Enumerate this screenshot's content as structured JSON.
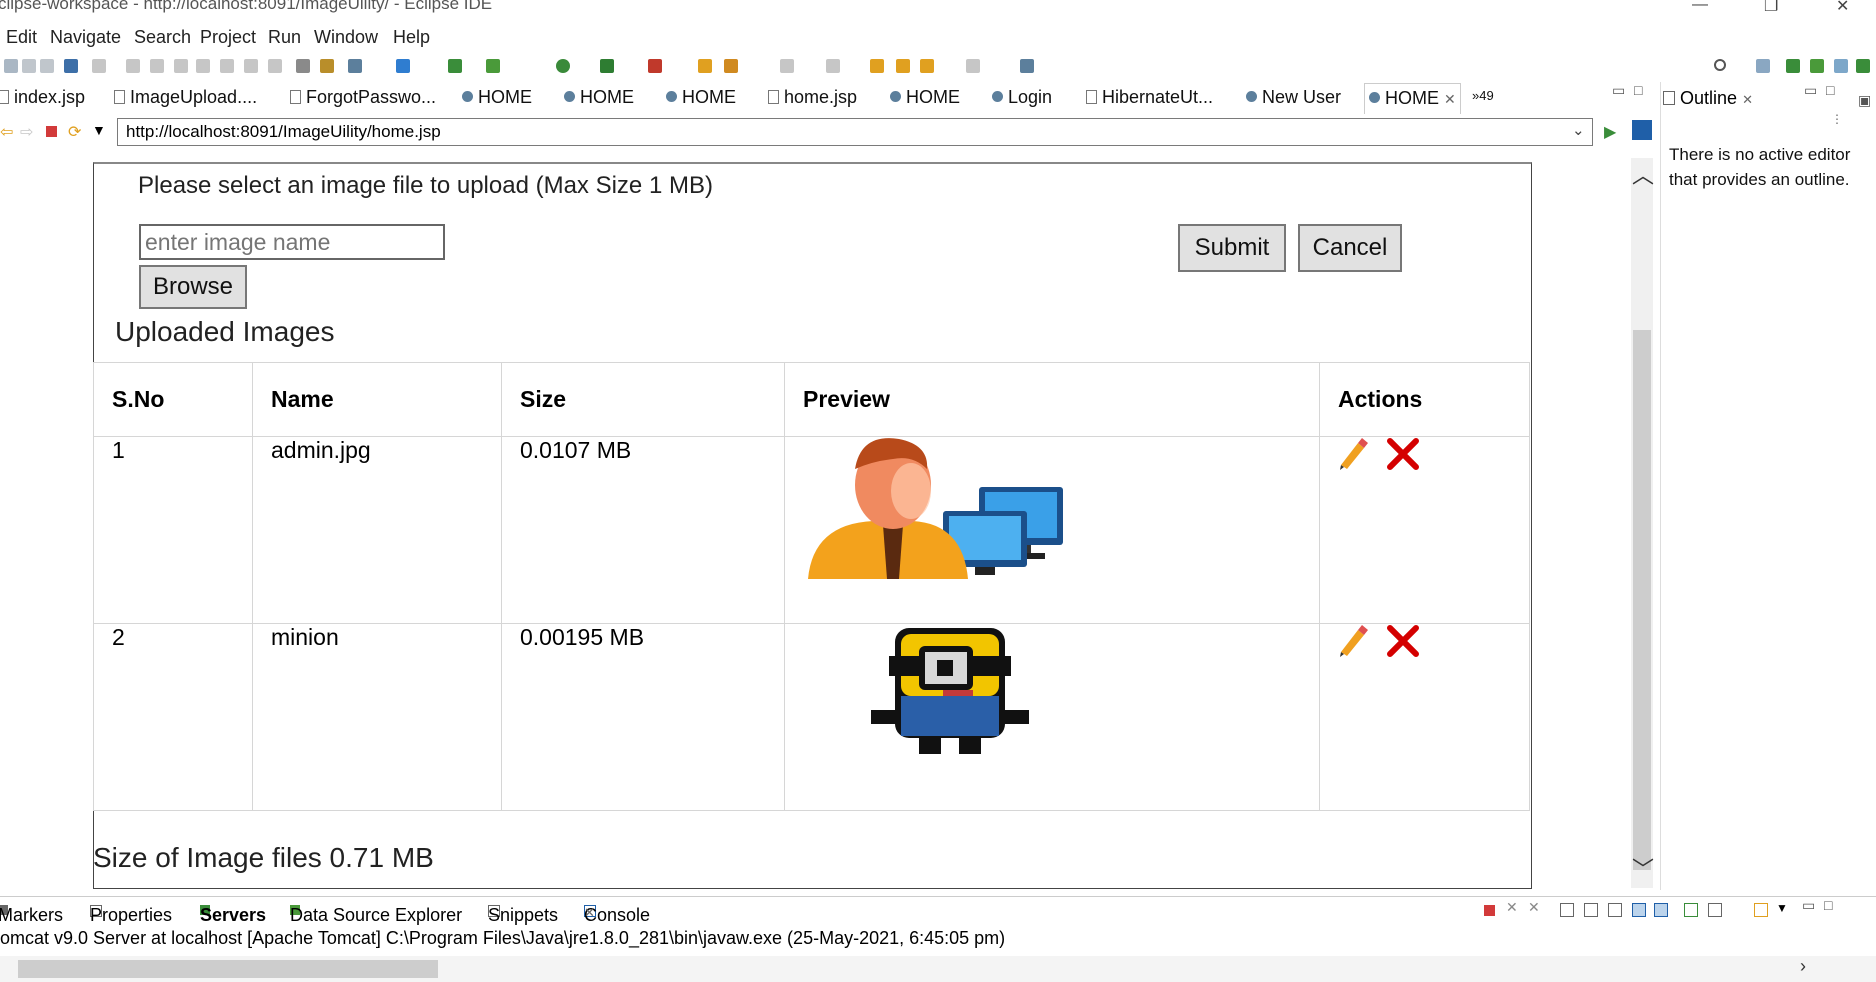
{
  "window": {
    "title": "clipse-workspace - http://localhost:8091/ImageUility/ - Eclipse IDE",
    "controls": [
      "—",
      "❐",
      "✕"
    ]
  },
  "menu": [
    "Edit",
    "Navigate",
    "Search",
    "Project",
    "Run",
    "Window",
    "Help"
  ],
  "tabs": [
    {
      "label": "index.jsp",
      "kind": "doc"
    },
    {
      "label": "ImageUpload....",
      "kind": "doc"
    },
    {
      "label": "ForgotPasswo...",
      "kind": "doc"
    },
    {
      "label": "HOME",
      "kind": "web"
    },
    {
      "label": "HOME",
      "kind": "web"
    },
    {
      "label": "HOME",
      "kind": "web"
    },
    {
      "label": "home.jsp",
      "kind": "doc"
    },
    {
      "label": "HOME",
      "kind": "web"
    },
    {
      "label": "Login",
      "kind": "web"
    },
    {
      "label": "HibernateUt...",
      "kind": "doc"
    },
    {
      "label": "New User",
      "kind": "web"
    },
    {
      "label": "HOME",
      "kind": "web",
      "active": true
    }
  ],
  "tab_overflow": "»49",
  "url": "http://localhost:8091/ImageUility/home.jsp",
  "page": {
    "upload_prompt": "Please select an image file to upload (Max Size 1 MB)",
    "image_name_placeholder": "enter image name",
    "browse_label": "Browse",
    "submit_label": "Submit",
    "cancel_label": "Cancel",
    "uploaded_heading": "Uploaded Images",
    "table": {
      "headers": [
        "S.No",
        "Name",
        "Size",
        "Preview",
        "Actions"
      ],
      "rows": [
        {
          "sno": "1",
          "name": "admin.jpg",
          "size": "0.0107 MB",
          "preview": "admin-user-computer-image"
        },
        {
          "sno": "2",
          "name": "minion",
          "size": "0.00195 MB",
          "preview": "pixel-minion-image"
        }
      ]
    },
    "total_size": "Size of Image files 0.71 MB"
  },
  "outline": {
    "title": "Outline",
    "message": "There is no active editor that provides an outline."
  },
  "bottom_tabs": [
    "Markers",
    "Properties",
    "Servers",
    "Data Source Explorer",
    "Snippets",
    "Console"
  ],
  "console_line": "omcat v9.0 Server at localhost [Apache Tomcat] C:\\Program Files\\Java\\jre1.8.0_281\\bin\\javaw.exe  (25-May-2021, 6:45:05 pm)",
  "colors": {
    "delete": "#d40000",
    "edit": "#f0a020",
    "accent": "#1f5fa8"
  }
}
